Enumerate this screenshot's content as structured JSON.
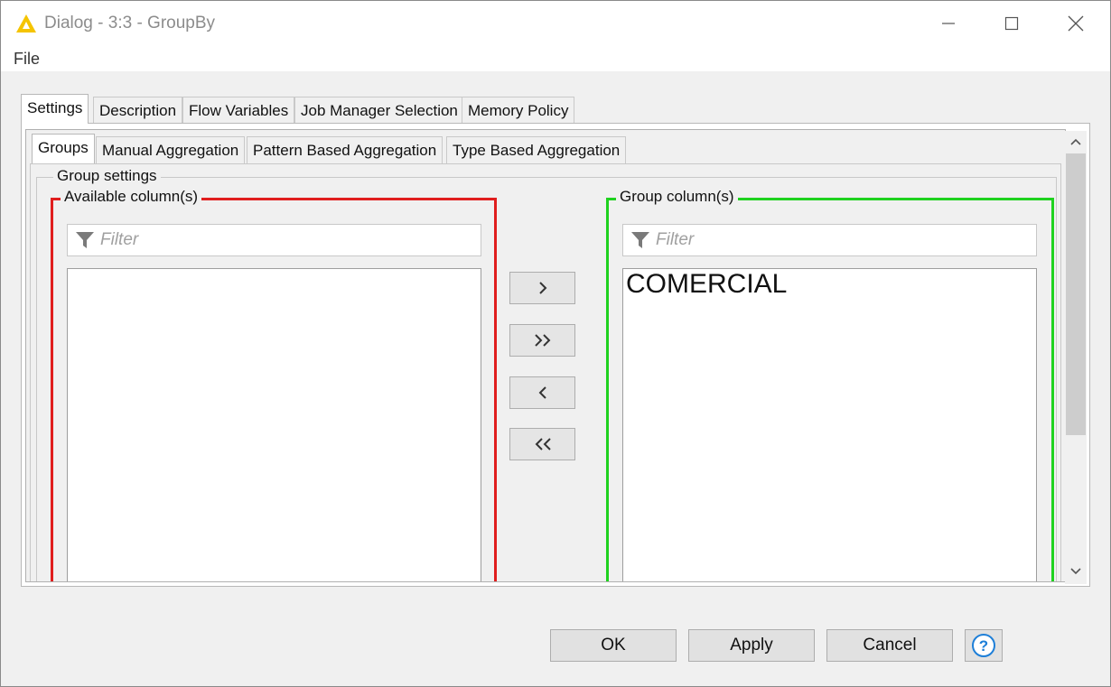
{
  "window": {
    "title": "Dialog - 3:3 - GroupBy",
    "menu": [
      "File"
    ]
  },
  "outer_tabs": [
    {
      "label": "Settings",
      "active": true
    },
    {
      "label": "Description",
      "active": false
    },
    {
      "label": "Flow Variables",
      "active": false
    },
    {
      "label": "Job Manager Selection",
      "active": false
    },
    {
      "label": "Memory Policy",
      "active": false
    }
  ],
  "inner_tabs": [
    {
      "label": "Groups",
      "active": true
    },
    {
      "label": "Manual Aggregation",
      "active": false
    },
    {
      "label": "Pattern Based Aggregation",
      "active": false
    },
    {
      "label": "Type Based Aggregation",
      "active": false
    }
  ],
  "group_settings": {
    "legend": "Group settings",
    "available": {
      "legend": "Available column(s)",
      "filter_placeholder": "Filter",
      "border_color": "#e01e1e",
      "items": []
    },
    "group": {
      "legend": "Group column(s)",
      "filter_placeholder": "Filter",
      "border_color": "#1fd21f",
      "items": [
        "COMERCIAL"
      ]
    },
    "move_buttons": [
      "add-icon",
      "add-all-icon",
      "remove-icon",
      "remove-all-icon"
    ]
  },
  "footer": {
    "ok": "OK",
    "apply": "Apply",
    "cancel": "Cancel",
    "help_icon": "help-icon"
  }
}
